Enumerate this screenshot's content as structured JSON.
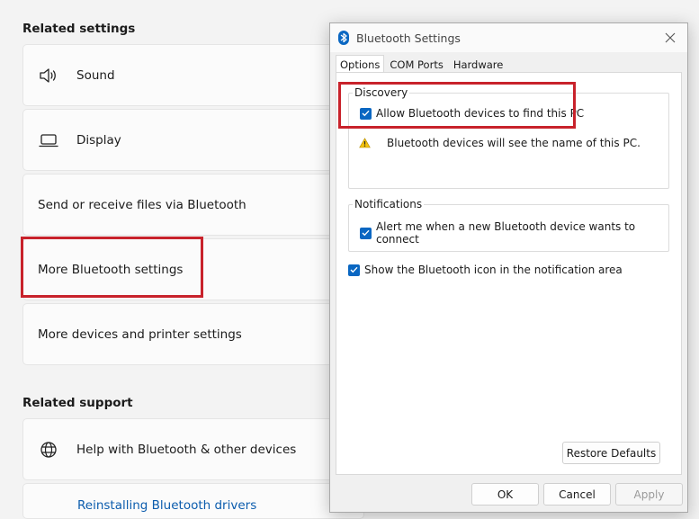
{
  "settings": {
    "related_settings_header": "Related settings",
    "items": [
      {
        "label": "Sound",
        "icon": "speaker-icon"
      },
      {
        "label": "Display",
        "icon": "laptop-icon"
      },
      {
        "label": "Send or receive files via Bluetooth"
      },
      {
        "label": "More Bluetooth settings"
      },
      {
        "label": "More devices and printer settings"
      }
    ],
    "related_support_header": "Related support",
    "support_items": [
      {
        "label": "Help with Bluetooth & other devices",
        "icon": "globe-icon"
      }
    ],
    "partial_link": "Reinstalling Bluetooth drivers"
  },
  "dialog": {
    "title": "Bluetooth Settings",
    "tabs": [
      "Options",
      "COM Ports",
      "Hardware"
    ],
    "discovery": {
      "label": "Discovery",
      "allow_find": "Allow Bluetooth devices to find this PC",
      "warning": "Bluetooth devices will see the name of this PC."
    },
    "notifications": {
      "label": "Notifications",
      "alert": "Alert me when a new Bluetooth device wants to connect"
    },
    "show_icon": "Show the Bluetooth icon in the notification area",
    "buttons": {
      "restore": "Restore Defaults",
      "ok": "OK",
      "cancel": "Cancel",
      "apply": "Apply"
    }
  },
  "colors": {
    "accent": "#0a67c2",
    "highlight_box": "#c8222b"
  }
}
